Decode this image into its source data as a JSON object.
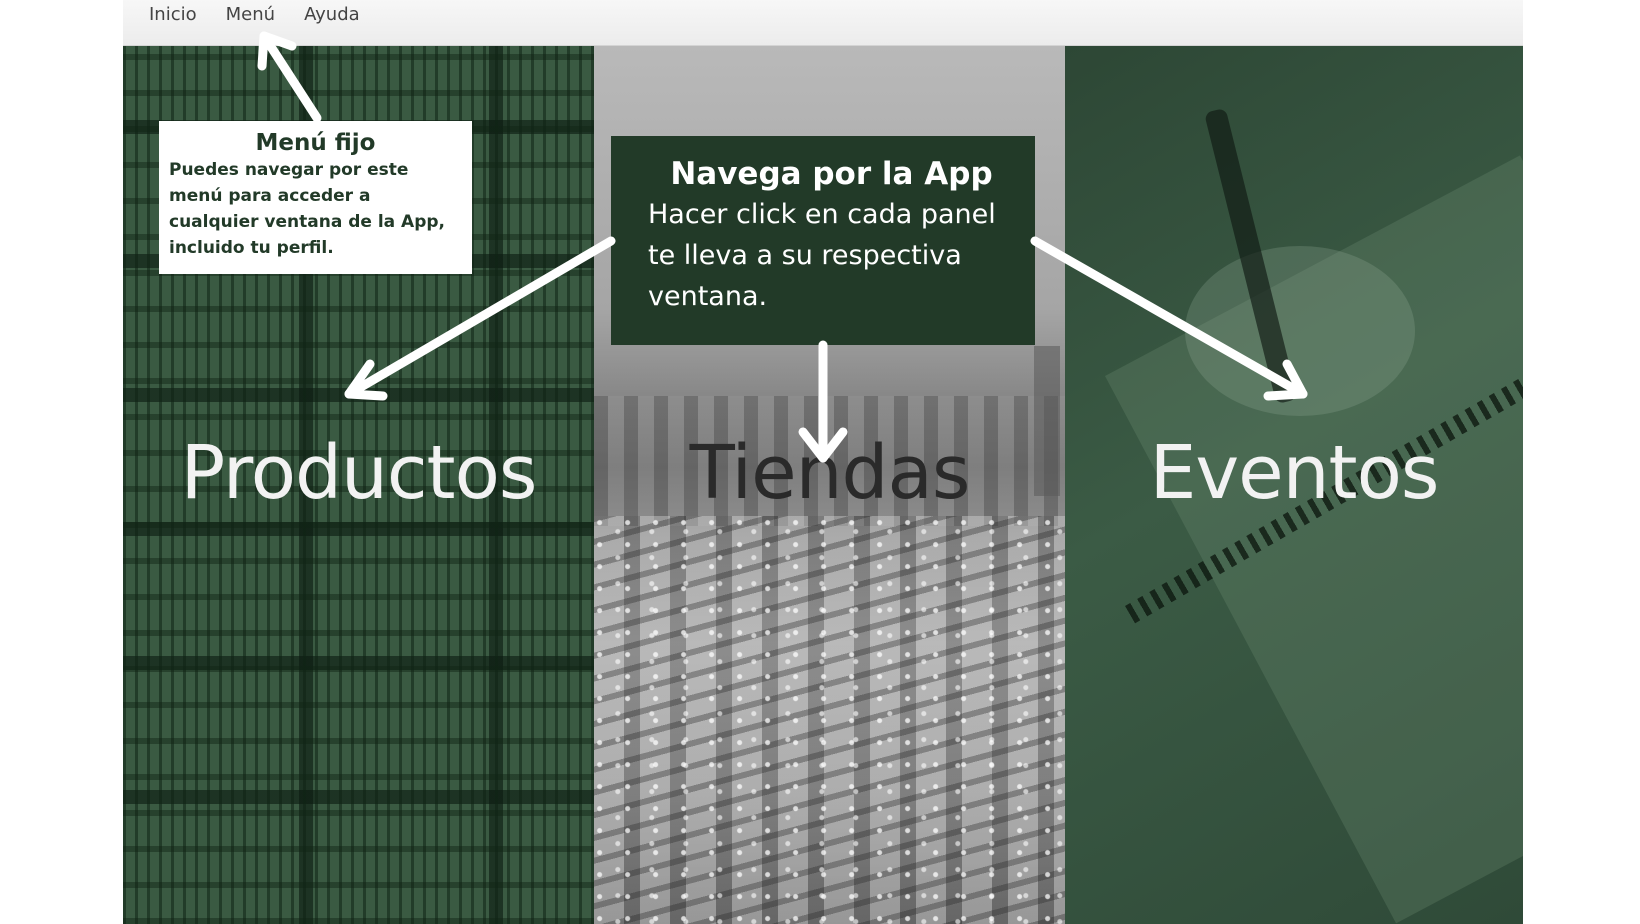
{
  "menubar": {
    "items": [
      "Inicio",
      "Menú",
      "Ayuda"
    ]
  },
  "panels": {
    "products": "Productos",
    "stores": "Tiendas",
    "events": "Eventos"
  },
  "callouts": {
    "menu": {
      "title": "Menú fijo",
      "body": "Puedes navegar por este menú para acceder a cualquier ventana de la App, incluido tu perfil."
    },
    "nav": {
      "title": "Navega por la App",
      "body": "Hacer click en cada panel te lleva a su respectiva ventana."
    }
  },
  "colors": {
    "dark_green": "#223a28",
    "panel_green": "#3a5a42",
    "menubar": "#ececec",
    "arrow": "#ffffff"
  }
}
